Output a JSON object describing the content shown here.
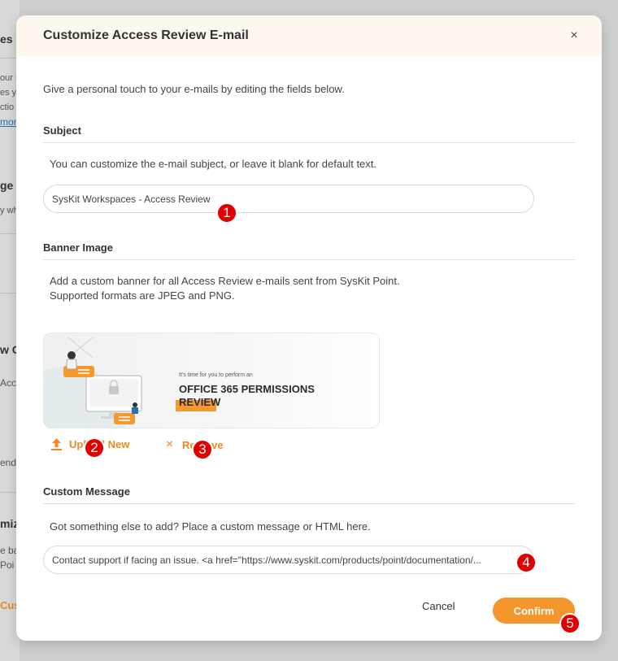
{
  "background": {
    "fragments": [
      "es",
      "our s",
      "es y",
      "ctio",
      "mor",
      "ge",
      "y wh",
      "w O",
      "Acce",
      "end",
      "miz",
      "e ba",
      "Poi",
      "Cus"
    ]
  },
  "modal": {
    "title": "Customize Access Review E-mail",
    "close_icon": "×",
    "intro": "Give a personal touch to your e-mails by editing the fields below.",
    "subject": {
      "title": "Subject",
      "help": "You can customize the e-mail subject, or leave it blank for default text.",
      "value": "SysKit Workspaces - Access Review"
    },
    "banner": {
      "title": "Banner Image",
      "help_line1": "Add a custom banner for all Access Review e-mails sent from SysKit Point.",
      "help_line2": "Supported formats are JPEG and PNG.",
      "image_tagline": "It's time for you to perform an",
      "image_heading_line1": "OFFICE 365 PERMISSIONS",
      "image_heading_line2": "REVIEW",
      "upload_label": "Upload New",
      "remove_label": "Remove"
    },
    "custom_message": {
      "title": "Custom Message",
      "help": "Got something else to add? Place a custom message or HTML here.",
      "value": "Contact support if facing an issue. <a href=\"https://www.syskit.com/products/point/documentation/..."
    },
    "cancel_label": "Cancel",
    "confirm_label": "Confirm"
  },
  "annotations": [
    "1",
    "2",
    "3",
    "4",
    "5"
  ],
  "colors": {
    "accent": "#f5962a",
    "badge": "#e00000",
    "header_bg": "#fdf7f0"
  }
}
